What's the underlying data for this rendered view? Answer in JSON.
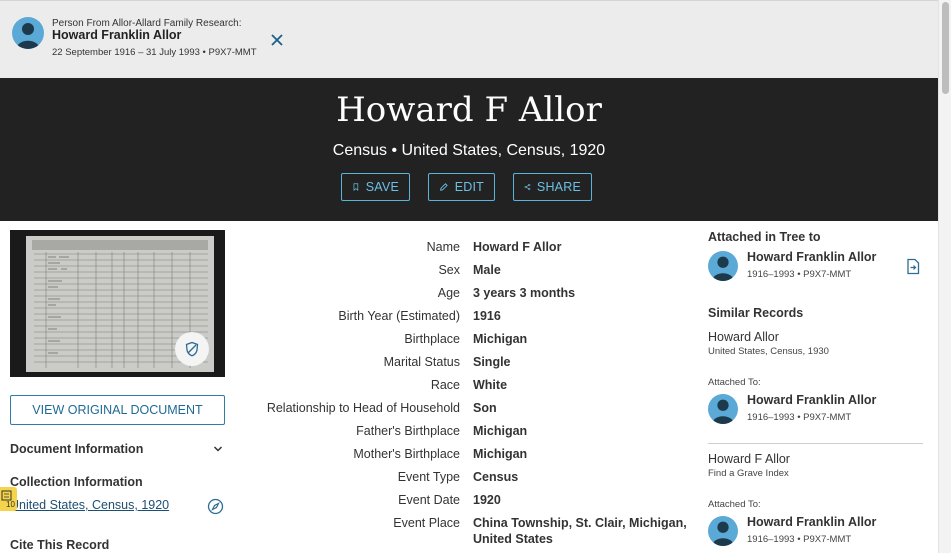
{
  "topbar": {
    "source_label": "Person From Allor-Allard Family Research:",
    "person_name": "Howard Franklin Allor",
    "person_dates": "22 September 1916 – 31 July 1993 • P9X7-MMT"
  },
  "hero": {
    "title": "Howard F Allor",
    "subtitle": "Census • United States, Census, 1920",
    "buttons": {
      "save": "SAVE",
      "edit": "EDIT",
      "share": "SHARE"
    }
  },
  "left": {
    "view_original": "VIEW ORIGINAL DOCUMENT",
    "document_information": "Document Information",
    "collection_information": "Collection Information",
    "collection_link": "United States, Census, 1920",
    "cite_this_record": "Cite This Record",
    "side_tab_count": "10"
  },
  "facts": [
    {
      "label": "Name",
      "value": "Howard F Allor"
    },
    {
      "label": "Sex",
      "value": "Male"
    },
    {
      "label": "Age",
      "value": "3 years 3 months"
    },
    {
      "label": "Birth Year (Estimated)",
      "value": "1916"
    },
    {
      "label": "Birthplace",
      "value": "Michigan"
    },
    {
      "label": "Marital Status",
      "value": "Single"
    },
    {
      "label": "Race",
      "value": "White"
    },
    {
      "label": "Relationship to Head of Household",
      "value": "Son"
    },
    {
      "label": "Father's Birthplace",
      "value": "Michigan"
    },
    {
      "label": "Mother's Birthplace",
      "value": "Michigan"
    },
    {
      "label": "Event Type",
      "value": "Census"
    },
    {
      "label": "Event Date",
      "value": "1920"
    },
    {
      "label": "Event Place",
      "value": "China Township, St. Clair, Michigan,",
      "value2": "United States"
    }
  ],
  "right": {
    "attached_heading": "Attached in Tree to",
    "attached_person": {
      "name": "Howard Franklin Allor",
      "meta": "1916–1993 • P9X7-MMT"
    },
    "similar_heading": "Similar Records",
    "similar": [
      {
        "title": "Howard Allor",
        "source": "United States, Census, 1930",
        "attached_label": "Attached To:",
        "person_name": "Howard Franklin Allor",
        "person_meta": "1916–1993 • P9X7-MMT"
      },
      {
        "title": "Howard F Allor",
        "source": "Find a Grave Index",
        "attached_label": "Attached To:",
        "person_name": "Howard Franklin Allor",
        "person_meta": "1916–1993 • P9X7-MMT"
      }
    ]
  },
  "colors": {
    "hero_bg": "#222222",
    "accent": "#5ab3d9",
    "link": "#1d4f72",
    "avatar": "#5aa9d6"
  }
}
